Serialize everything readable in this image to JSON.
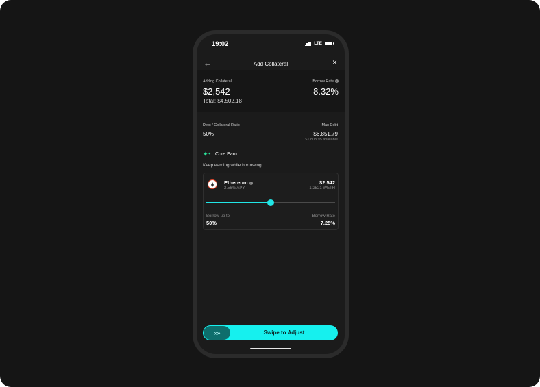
{
  "status": {
    "time": "19:02",
    "network": "LTE"
  },
  "header": {
    "title": "Add Collateral"
  },
  "summary": {
    "adding_label": "Adding Collateral",
    "adding_value": "$2,542",
    "total": "Total: $4,502.18",
    "borrow_rate_label": "Borrow Rate",
    "borrow_rate_value": "8.32%"
  },
  "ratio": {
    "label": "Debt / Collateral Ratio",
    "value": "50%",
    "max_debt_label": "Max Debt",
    "max_debt_value": "$6,851.79",
    "available": "$1,803.95 available"
  },
  "earn": {
    "title": "Core Earn",
    "description": "Keep earning while borrowing."
  },
  "asset": {
    "name": "Ethereum",
    "apy": "2.56% APY",
    "usd_value": "$2,542",
    "amount": "1.2521 WETH",
    "slider_fraction": 0.5,
    "borrow_up_to_label": "Borrow up to",
    "borrow_up_to_value": "50%",
    "borrow_rate_label": "Borrow Rate",
    "borrow_rate_value": "7.25%"
  },
  "swipe": {
    "handle": "»»",
    "label": "Swipe to Adjust"
  },
  "colors": {
    "accent": "#16f0ee",
    "earn_icon": "#2be39a",
    "eth_ring": "#e2492f"
  }
}
